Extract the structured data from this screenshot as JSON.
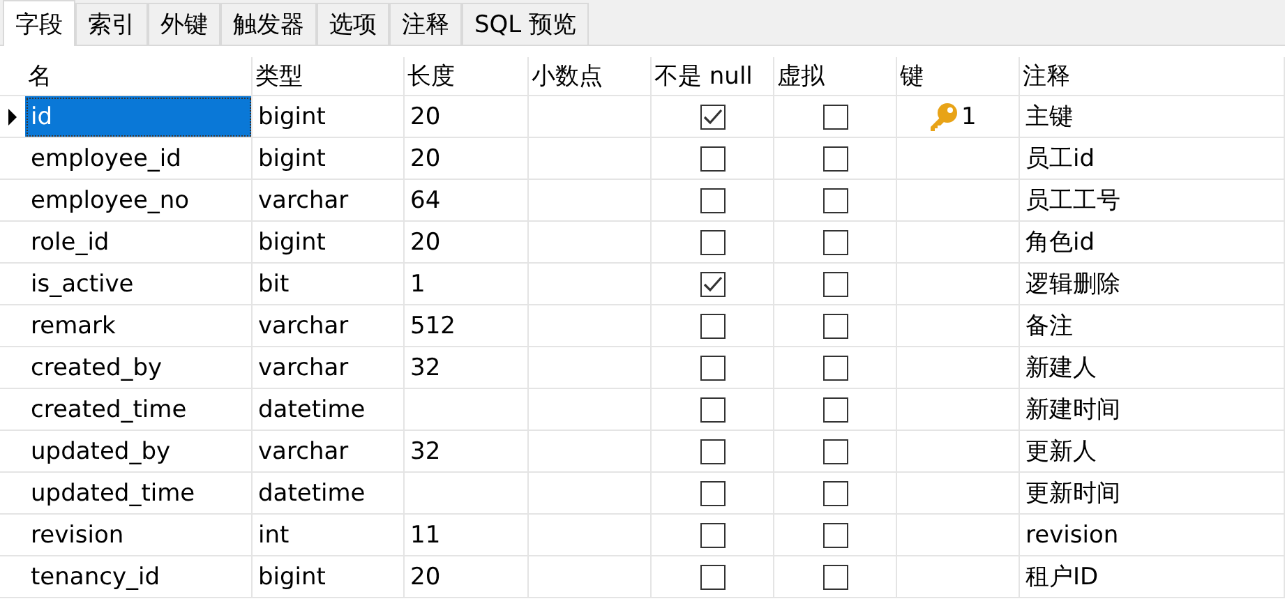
{
  "tabs": [
    {
      "label": "字段",
      "selected": true
    },
    {
      "label": "索引",
      "selected": false
    },
    {
      "label": "外键",
      "selected": false
    },
    {
      "label": "触发器",
      "selected": false
    },
    {
      "label": "选项",
      "selected": false
    },
    {
      "label": "注释",
      "selected": false
    },
    {
      "label": "SQL 预览",
      "selected": false
    }
  ],
  "table": {
    "columns": [
      "名",
      "类型",
      "长度",
      "小数点",
      "不是 null",
      "虚拟",
      "键",
      "注释"
    ],
    "rows": [
      {
        "selected": true,
        "name": "id",
        "type": "bigint",
        "length": "20",
        "not_null": true,
        "virtual": false,
        "key": "1",
        "comment": "主键"
      },
      {
        "selected": false,
        "name": "employee_id",
        "type": "bigint",
        "length": "20",
        "not_null": false,
        "virtual": false,
        "comment": "员工id"
      },
      {
        "selected": false,
        "name": "employee_no",
        "type": "varchar",
        "length": "64",
        "not_null": false,
        "virtual": false,
        "comment": "员工工号"
      },
      {
        "selected": false,
        "name": "role_id",
        "type": "bigint",
        "length": "20",
        "not_null": false,
        "virtual": false,
        "comment": "角色id"
      },
      {
        "selected": false,
        "name": "is_active",
        "type": "bit",
        "length": "1",
        "not_null": true,
        "virtual": false,
        "comment": "逻辑删除"
      },
      {
        "selected": false,
        "name": "remark",
        "type": "varchar",
        "length": "512",
        "not_null": false,
        "virtual": false,
        "comment": "备注"
      },
      {
        "selected": false,
        "name": "created_by",
        "type": "varchar",
        "length": "32",
        "not_null": false,
        "virtual": false,
        "comment": "新建人"
      },
      {
        "selected": false,
        "name": "created_time",
        "type": "datetime",
        "not_null": false,
        "virtual": false,
        "comment": "新建时间"
      },
      {
        "selected": false,
        "name": "updated_by",
        "type": "varchar",
        "length": "32",
        "not_null": false,
        "virtual": false,
        "comment": "更新人"
      },
      {
        "selected": false,
        "name": "updated_time",
        "type": "datetime",
        "not_null": false,
        "virtual": false,
        "comment": "更新时间"
      },
      {
        "selected": false,
        "name": "revision",
        "type": "int",
        "length": "11",
        "not_null": false,
        "virtual": false,
        "comment": "revision"
      },
      {
        "selected": false,
        "name": "tenancy_id",
        "type": "bigint",
        "length": "20",
        "not_null": false,
        "virtual": false,
        "comment": "租户ID"
      }
    ]
  }
}
